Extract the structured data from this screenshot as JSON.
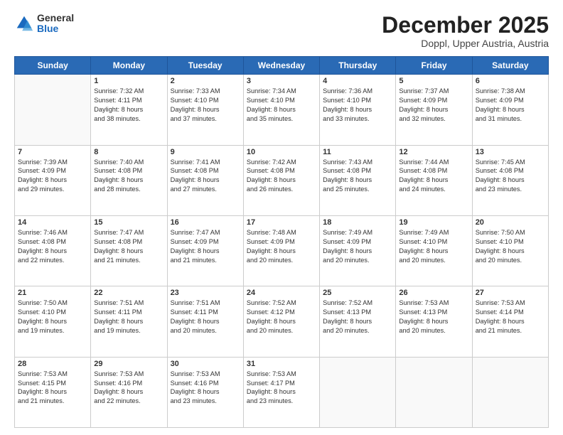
{
  "logo": {
    "general": "General",
    "blue": "Blue"
  },
  "header": {
    "month": "December 2025",
    "location": "Doppl, Upper Austria, Austria"
  },
  "weekdays": [
    "Sunday",
    "Monday",
    "Tuesday",
    "Wednesday",
    "Thursday",
    "Friday",
    "Saturday"
  ],
  "weeks": [
    [
      {
        "day": "",
        "info": ""
      },
      {
        "day": "1",
        "info": "Sunrise: 7:32 AM\nSunset: 4:11 PM\nDaylight: 8 hours\nand 38 minutes."
      },
      {
        "day": "2",
        "info": "Sunrise: 7:33 AM\nSunset: 4:10 PM\nDaylight: 8 hours\nand 37 minutes."
      },
      {
        "day": "3",
        "info": "Sunrise: 7:34 AM\nSunset: 4:10 PM\nDaylight: 8 hours\nand 35 minutes."
      },
      {
        "day": "4",
        "info": "Sunrise: 7:36 AM\nSunset: 4:10 PM\nDaylight: 8 hours\nand 33 minutes."
      },
      {
        "day": "5",
        "info": "Sunrise: 7:37 AM\nSunset: 4:09 PM\nDaylight: 8 hours\nand 32 minutes."
      },
      {
        "day": "6",
        "info": "Sunrise: 7:38 AM\nSunset: 4:09 PM\nDaylight: 8 hours\nand 31 minutes."
      }
    ],
    [
      {
        "day": "7",
        "info": "Sunrise: 7:39 AM\nSunset: 4:09 PM\nDaylight: 8 hours\nand 29 minutes."
      },
      {
        "day": "8",
        "info": "Sunrise: 7:40 AM\nSunset: 4:08 PM\nDaylight: 8 hours\nand 28 minutes."
      },
      {
        "day": "9",
        "info": "Sunrise: 7:41 AM\nSunset: 4:08 PM\nDaylight: 8 hours\nand 27 minutes."
      },
      {
        "day": "10",
        "info": "Sunrise: 7:42 AM\nSunset: 4:08 PM\nDaylight: 8 hours\nand 26 minutes."
      },
      {
        "day": "11",
        "info": "Sunrise: 7:43 AM\nSunset: 4:08 PM\nDaylight: 8 hours\nand 25 minutes."
      },
      {
        "day": "12",
        "info": "Sunrise: 7:44 AM\nSunset: 4:08 PM\nDaylight: 8 hours\nand 24 minutes."
      },
      {
        "day": "13",
        "info": "Sunrise: 7:45 AM\nSunset: 4:08 PM\nDaylight: 8 hours\nand 23 minutes."
      }
    ],
    [
      {
        "day": "14",
        "info": "Sunrise: 7:46 AM\nSunset: 4:08 PM\nDaylight: 8 hours\nand 22 minutes."
      },
      {
        "day": "15",
        "info": "Sunrise: 7:47 AM\nSunset: 4:08 PM\nDaylight: 8 hours\nand 21 minutes."
      },
      {
        "day": "16",
        "info": "Sunrise: 7:47 AM\nSunset: 4:09 PM\nDaylight: 8 hours\nand 21 minutes."
      },
      {
        "day": "17",
        "info": "Sunrise: 7:48 AM\nSunset: 4:09 PM\nDaylight: 8 hours\nand 20 minutes."
      },
      {
        "day": "18",
        "info": "Sunrise: 7:49 AM\nSunset: 4:09 PM\nDaylight: 8 hours\nand 20 minutes."
      },
      {
        "day": "19",
        "info": "Sunrise: 7:49 AM\nSunset: 4:10 PM\nDaylight: 8 hours\nand 20 minutes."
      },
      {
        "day": "20",
        "info": "Sunrise: 7:50 AM\nSunset: 4:10 PM\nDaylight: 8 hours\nand 20 minutes."
      }
    ],
    [
      {
        "day": "21",
        "info": "Sunrise: 7:50 AM\nSunset: 4:10 PM\nDaylight: 8 hours\nand 19 minutes."
      },
      {
        "day": "22",
        "info": "Sunrise: 7:51 AM\nSunset: 4:11 PM\nDaylight: 8 hours\nand 19 minutes."
      },
      {
        "day": "23",
        "info": "Sunrise: 7:51 AM\nSunset: 4:11 PM\nDaylight: 8 hours\nand 20 minutes."
      },
      {
        "day": "24",
        "info": "Sunrise: 7:52 AM\nSunset: 4:12 PM\nDaylight: 8 hours\nand 20 minutes."
      },
      {
        "day": "25",
        "info": "Sunrise: 7:52 AM\nSunset: 4:13 PM\nDaylight: 8 hours\nand 20 minutes."
      },
      {
        "day": "26",
        "info": "Sunrise: 7:53 AM\nSunset: 4:13 PM\nDaylight: 8 hours\nand 20 minutes."
      },
      {
        "day": "27",
        "info": "Sunrise: 7:53 AM\nSunset: 4:14 PM\nDaylight: 8 hours\nand 21 minutes."
      }
    ],
    [
      {
        "day": "28",
        "info": "Sunrise: 7:53 AM\nSunset: 4:15 PM\nDaylight: 8 hours\nand 21 minutes."
      },
      {
        "day": "29",
        "info": "Sunrise: 7:53 AM\nSunset: 4:16 PM\nDaylight: 8 hours\nand 22 minutes."
      },
      {
        "day": "30",
        "info": "Sunrise: 7:53 AM\nSunset: 4:16 PM\nDaylight: 8 hours\nand 23 minutes."
      },
      {
        "day": "31",
        "info": "Sunrise: 7:53 AM\nSunset: 4:17 PM\nDaylight: 8 hours\nand 23 minutes."
      },
      {
        "day": "",
        "info": ""
      },
      {
        "day": "",
        "info": ""
      },
      {
        "day": "",
        "info": ""
      }
    ]
  ]
}
